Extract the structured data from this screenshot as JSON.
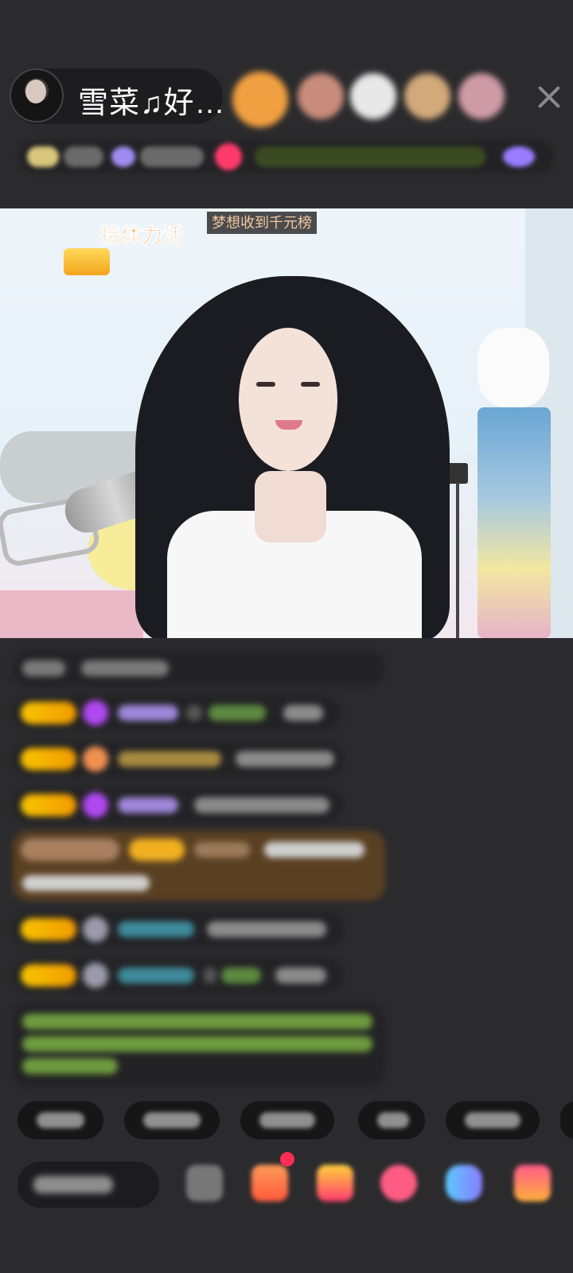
{
  "header": {
    "host_name": "雪菜♫好…",
    "close_icon": "close-icon",
    "viewer_avatar_colors": [
      "#f0a040",
      "#c98c7c",
      "#e8e8e8",
      "#d2a97a",
      "#cf9ba6"
    ]
  },
  "video": {
    "overlay_banner": "梦想收到千元榜",
    "tag_text": "接体力活"
  },
  "colors": {
    "background": "#2b2b2d",
    "level_badge": "#f7c400",
    "chat_highlight": "#5a4023",
    "system_text": "#8ccf5a"
  }
}
